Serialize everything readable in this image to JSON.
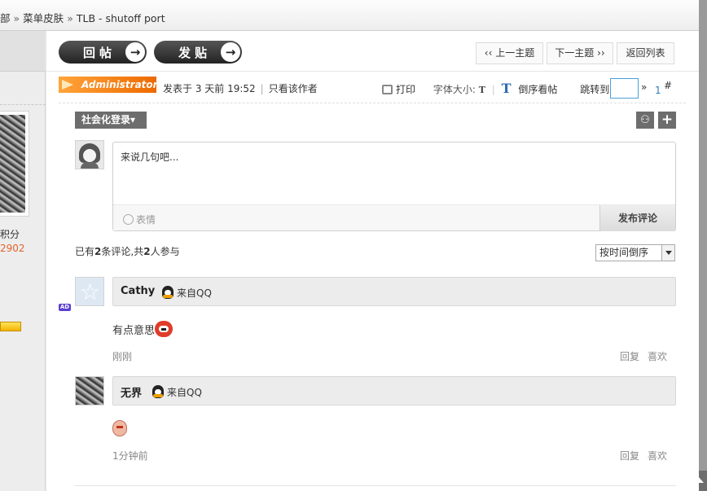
{
  "breadcrumb": {
    "part1": "部",
    "part2": "菜单皮肤",
    "part3": "TLB - shutoff port",
    "sep": "»"
  },
  "left": {
    "label": "积分",
    "value": "2902"
  },
  "buttons": {
    "reply": "回帖",
    "post": "发贴",
    "arrow": "→"
  },
  "nav": {
    "prev": "‹‹ 上一主题",
    "next": "下一主题 ››",
    "back": "返回列表"
  },
  "post": {
    "badge": "Administrator",
    "posted": "发表于 3 天前 19:52",
    "author_only": "只看该作者",
    "print": "打印",
    "font_size": "字体大小:",
    "font_small": "T",
    "font_big": "T",
    "reverse": "倒序看帖",
    "jump": "跳转到",
    "jump_arrow": "»",
    "page": "1",
    "hash": "#"
  },
  "social": {
    "login": "社会化登录▾",
    "user_icon": "user-icon",
    "plus_icon": "plus-icon"
  },
  "comment_box": {
    "placeholder": "来说几句吧...",
    "emoji": "表情",
    "submit": "发布评论"
  },
  "summary": {
    "prefix": "已有",
    "count": "2",
    "mid": "条评论,共",
    "people": "2",
    "suffix": "人参与"
  },
  "sort": {
    "selected": "按时间倒序"
  },
  "comments": [
    {
      "name": "Cathy",
      "source": "来自QQ",
      "text": "有点意思",
      "time": "刚刚",
      "reply": "回复",
      "like": "喜欢",
      "tag": "AD"
    },
    {
      "name": "无界",
      "source": "来自QQ",
      "text": "",
      "time": "1分钟前",
      "reply": "回复",
      "like": "喜欢"
    }
  ]
}
